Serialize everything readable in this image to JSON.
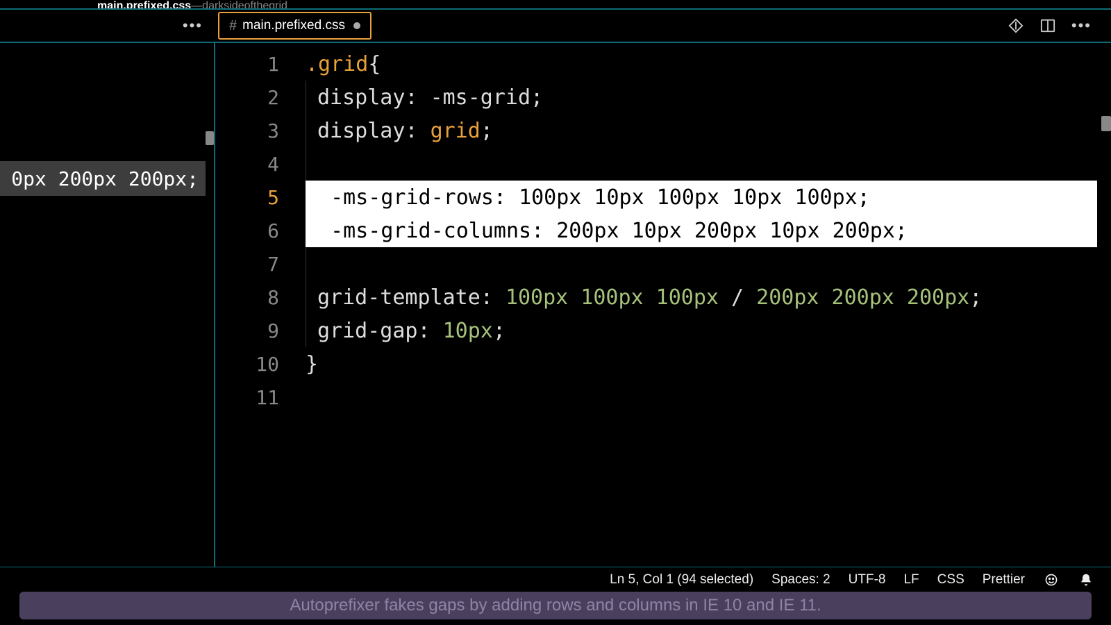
{
  "titlebar": {
    "file": "main.prefixed.css",
    "sep": " — ",
    "project": "darksideofthegrid"
  },
  "tab": {
    "name": "main.prefixed.css"
  },
  "sidebar": {
    "fragment": "0px 200px 200px;"
  },
  "gutter": [
    "1",
    "2",
    "3",
    "4",
    "5",
    "6",
    "7",
    "8",
    "9",
    "10",
    "11"
  ],
  "code": {
    "l1_selector": ".grid",
    "l1_brace": " {",
    "l2_prop": "display",
    "l2_val": "-ms-grid",
    "l3_prop": "display",
    "l3_val": "grid",
    "l5_prop": "-ms-grid-rows",
    "l5_vals": "100px 10px 100px 10px 100px",
    "l6_prop": "-ms-grid-columns",
    "l6_vals": "200px 10px 200px 10px 200px",
    "l8_prop": "grid-template",
    "l8_vals_a": "100px 100px 100px",
    "l8_slash": " / ",
    "l8_vals_b": "200px 200px 200px",
    "l9_prop": "grid-gap",
    "l9_val": "10px",
    "l10_brace": "}"
  },
  "status": {
    "pos": "Ln 5, Col 1 (94 selected)",
    "indent": "Spaces: 2",
    "encoding": "UTF-8",
    "eol": "LF",
    "lang": "CSS",
    "formatter": "Prettier"
  },
  "caption": "Autoprefixer fakes gaps by adding rows and columns in IE 10 and IE 11."
}
